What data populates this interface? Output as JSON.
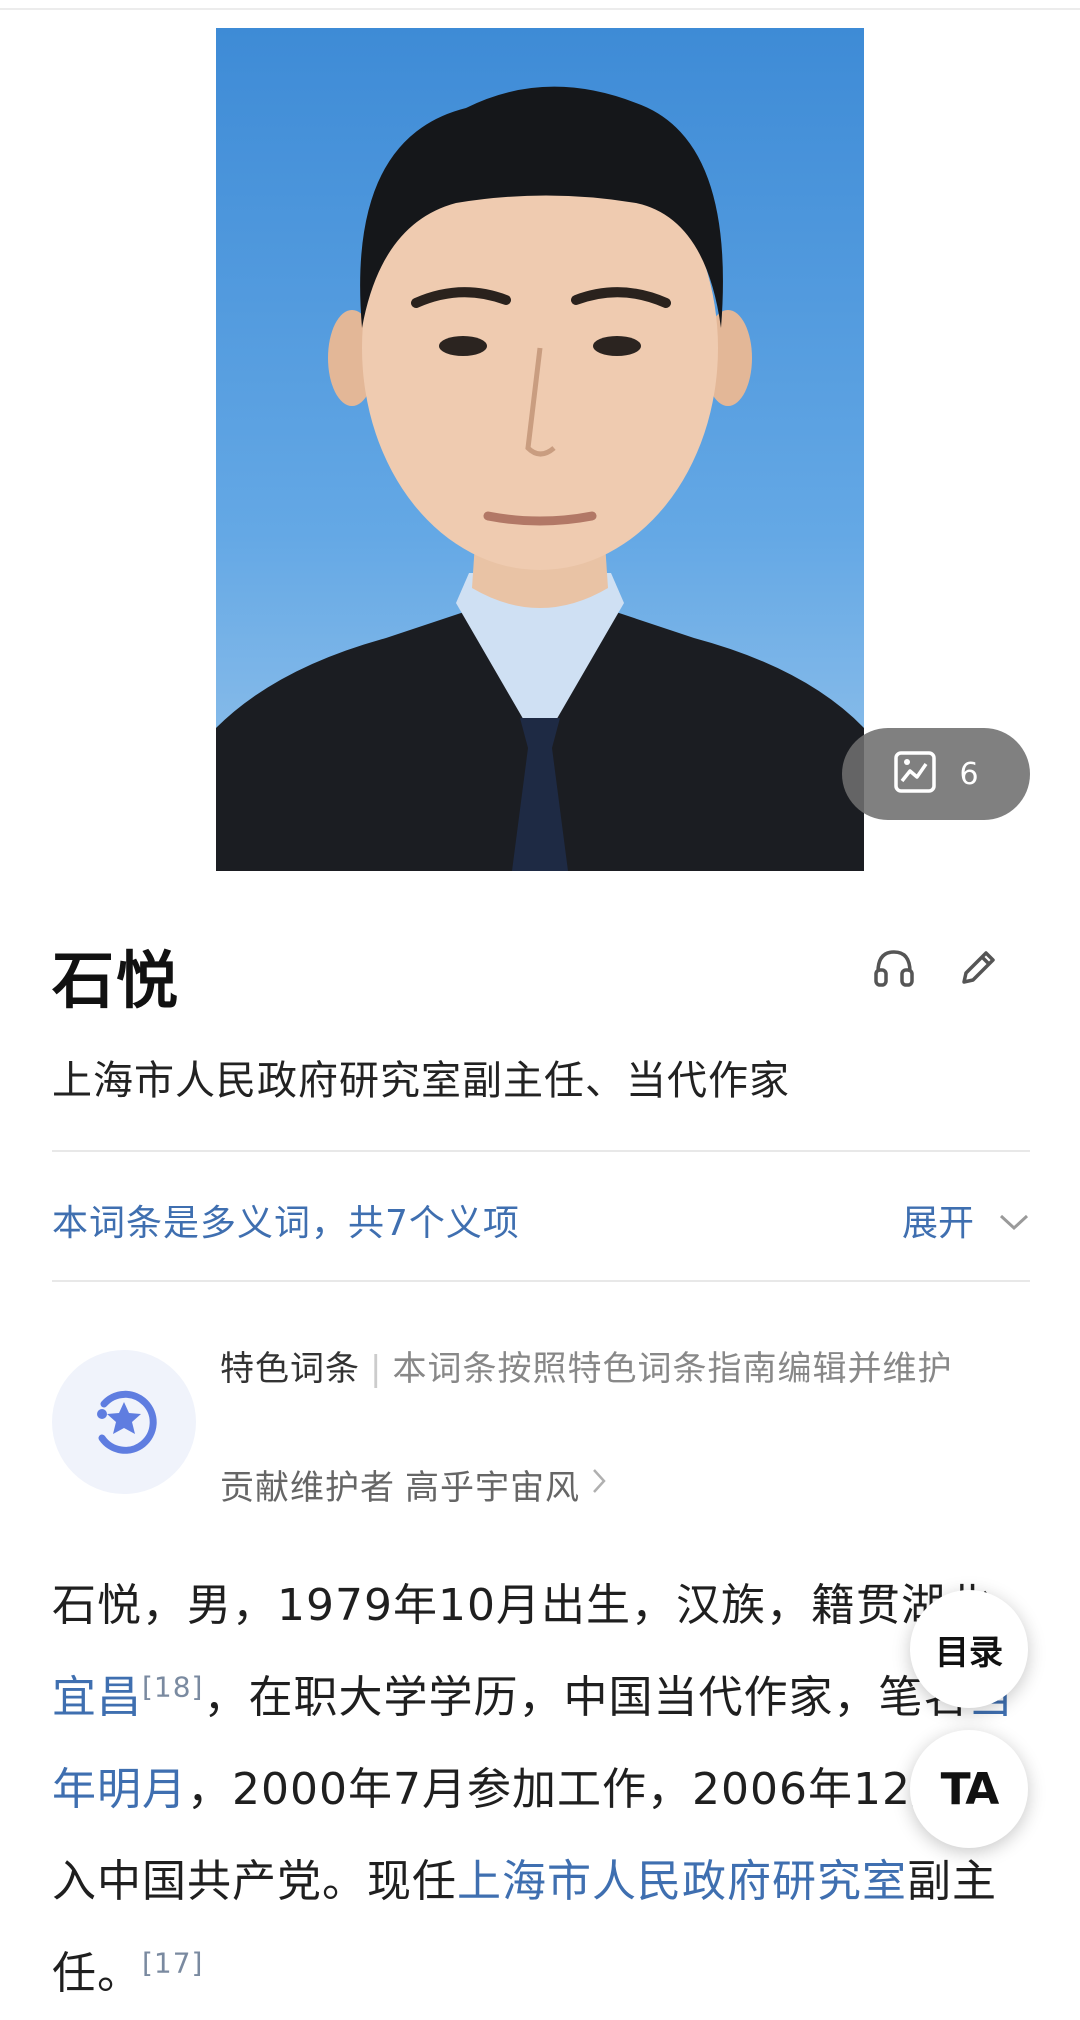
{
  "header": {
    "gallery_count": "6"
  },
  "entry": {
    "title": "石悦",
    "subtitle": "上海市人民政府研究室副主任、当代作家"
  },
  "polysemy": {
    "text": "本词条是多义词，共7个义项",
    "expand_label": "展开"
  },
  "feature": {
    "label": "特色词条",
    "description": "本词条按照特色词条指南编辑并维护",
    "contributor_prefix": "贡献维护者",
    "contributor_name": "高乎宇宙风"
  },
  "body": {
    "part1": "石悦，男，1979年10月出生，汉族，籍贯湖北",
    "link_yichang": "宜昌",
    "ref1": "[18]",
    "part2": "，在职大学学历，中国当代作家，笔名",
    "link_penname": "当年明月",
    "part3": "，2000年7月参加工作，2006年12月加入中国共产党。现任",
    "link_office": "上海市人民政府研究室",
    "part4": "副主任。",
    "ref2": "[17]"
  },
  "floating": {
    "toc_label": "目录",
    "font_label": "TA"
  },
  "colors": {
    "link": "#3f6fb0",
    "photo_bg": "#4f97dc"
  },
  "icons": [
    "gallery-icon",
    "headphones-icon",
    "edit-icon",
    "chevron-down-icon",
    "feature-star-icon",
    "chevron-right-icon"
  ]
}
